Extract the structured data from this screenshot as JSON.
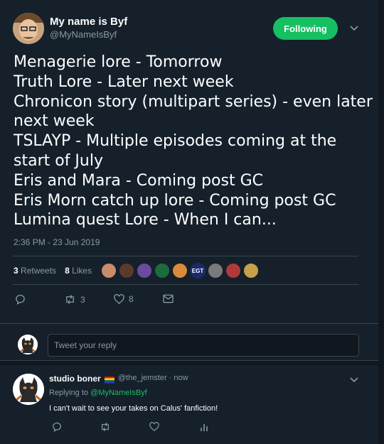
{
  "author": {
    "display_name": "My name is Byf",
    "handle": "@MyNameIsByf",
    "follow_label": "Following"
  },
  "tweet": {
    "lines": [
      "Menagerie lore - Tomorrow",
      "Truth Lore - Later next week",
      "Chronicon story (multipart series) - even later",
      "next week",
      "TSLAYP - Multiple episodes coming at the",
      "start of July",
      "Eris and Mara - Coming post GC",
      "Eris Morn catch up lore - Coming post GC",
      "Lumina quest Lore - When I can..."
    ],
    "timestamp": "2:36 PM - 23 Jun 2019",
    "retweet_count": "3",
    "retweet_label": "Retweets",
    "like_count": "8",
    "like_label": "Likes",
    "liker_badge": "EGT",
    "actions": {
      "retweet_count": "3",
      "like_count": "8"
    }
  },
  "reply_box": {
    "placeholder": "Tweet your reply"
  },
  "reply": {
    "display_name": "studio boner",
    "handle_time": "@the_jemster · now",
    "replying_prefix": "Replying to",
    "replying_to": "@MyNameIsByf",
    "text": "I can't wait to see your takes on Calus' fanfiction!"
  },
  "colors": {
    "background": "#15202b",
    "follow_green": "#17bf63",
    "muted_text": "#8899a6",
    "divider": "#38444d"
  },
  "icons": [
    "chevron-down-icon",
    "reply-icon",
    "retweet-icon",
    "like-icon",
    "message-icon",
    "analytics-icon"
  ]
}
